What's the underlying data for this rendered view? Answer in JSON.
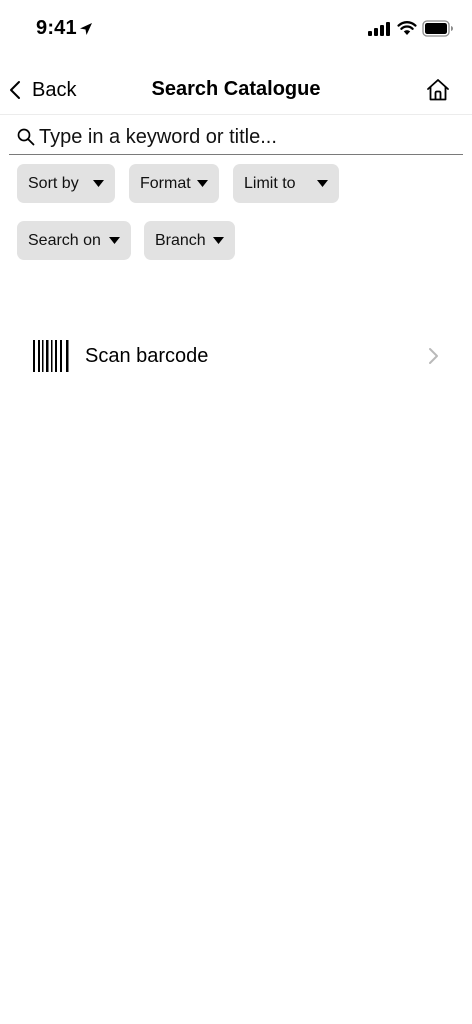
{
  "status_bar": {
    "time": "9:41",
    "icons": [
      "location-arrow-icon",
      "cellular-signal-icon",
      "wifi-icon",
      "battery-icon"
    ]
  },
  "nav": {
    "back_label": "Back",
    "title": "Search Catalogue",
    "home_icon": "home-icon"
  },
  "search": {
    "placeholder": "Type in a keyword or title...",
    "value": ""
  },
  "filters": [
    {
      "label": "Sort by"
    },
    {
      "label": "Format"
    },
    {
      "label": "Limit to"
    },
    {
      "label": "Search on"
    },
    {
      "label": "Branch"
    }
  ],
  "scan": {
    "label": "Scan barcode"
  },
  "colors": {
    "chip_background": "#e2e2e2",
    "text": "#000000",
    "chevron": "#b9b9b9",
    "divider": "#ececec"
  }
}
